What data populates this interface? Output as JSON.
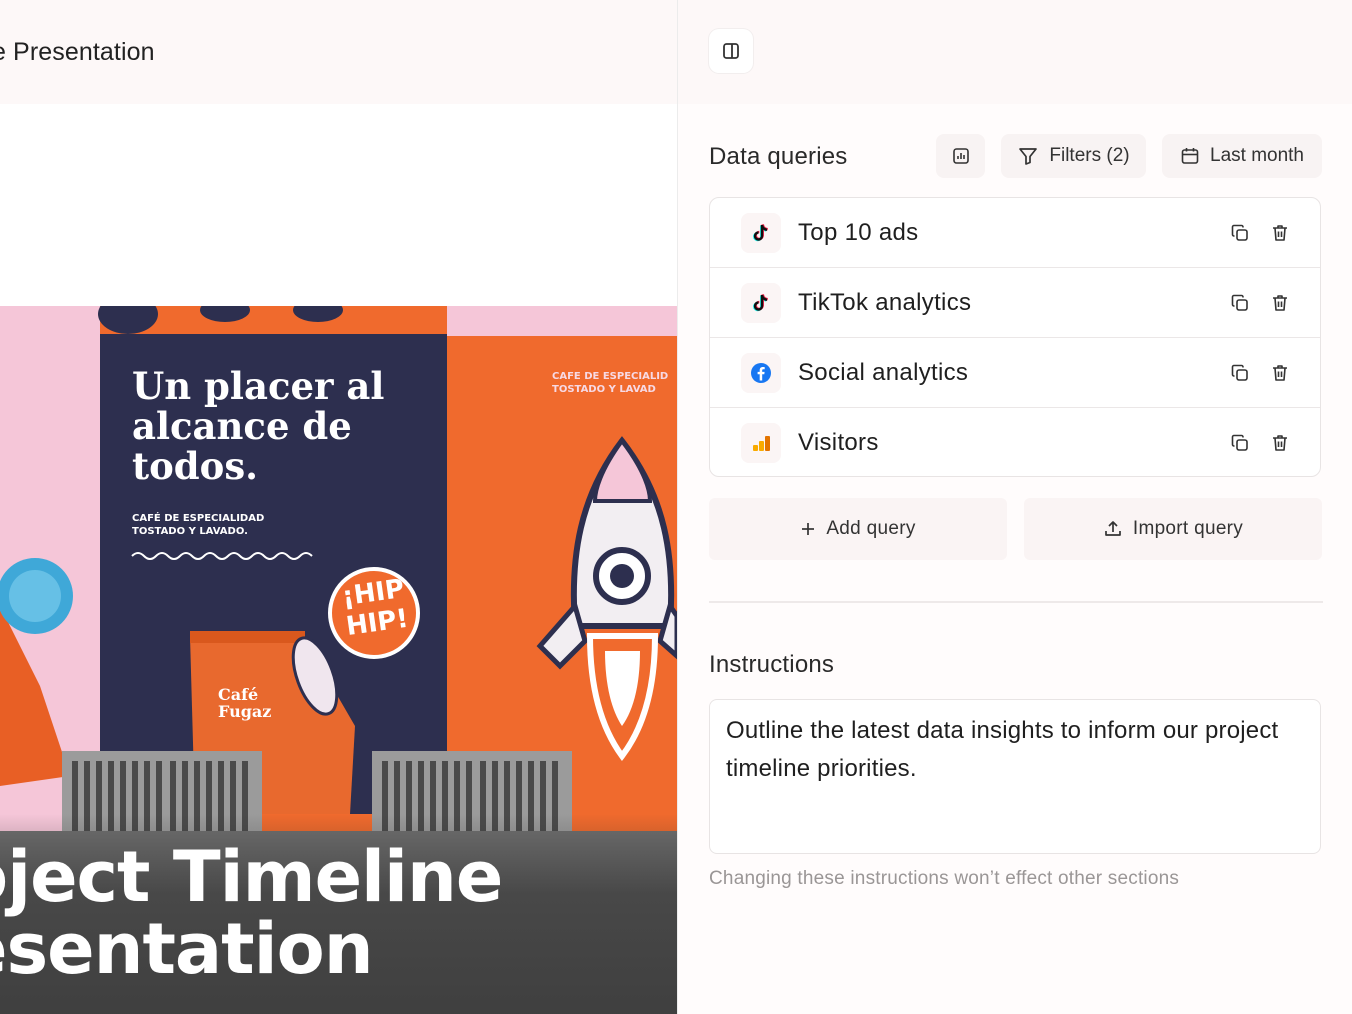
{
  "document": {
    "title": "e Presentation"
  },
  "hero": {
    "title_line1": "oject Timeline",
    "title_line2": "esentation",
    "poster_headline_1": "Un placer al",
    "poster_headline_2": "alcance de",
    "poster_headline_3": "todos.",
    "poster_sub_1": "CAFÉ DE ESPECIALIDAD",
    "poster_sub_2": "TOSTADO Y LAVADO.",
    "poster_side_1": "CAFE DE ESPECIALID",
    "poster_side_2": "TOSTADO Y LAVAD",
    "sticker_1": "¡HIP",
    "sticker_2": "HIP!",
    "bag_label_1": "Café",
    "bag_label_2": "Fugaz"
  },
  "sidebar": {
    "toggle_icon": "panel-right-icon",
    "data_queries": {
      "title": "Data queries",
      "chart_icon": "bar-chart-icon",
      "filters_label": "Filters (2)",
      "date_range_label": "Last month"
    },
    "queries": [
      {
        "label": "Top 10 ads",
        "icon": "tiktok-icon"
      },
      {
        "label": "TikTok analytics",
        "icon": "tiktok-icon"
      },
      {
        "label": "Social analytics",
        "icon": "facebook-icon"
      },
      {
        "label": "Visitors",
        "icon": "google-analytics-icon"
      }
    ],
    "add_query_label": "Add query",
    "import_query_label": "Import query",
    "instructions": {
      "title": "Instructions",
      "text": "Outline the latest data insights to inform our project timeline priorities.",
      "hint": "Changing these instructions won’t effect other sections"
    }
  },
  "colors": {
    "accent_orange": "#f06a2d",
    "poster_navy": "#2d2f4f",
    "poster_pink": "#f5c6d8",
    "facebook_blue": "#1877f2"
  }
}
